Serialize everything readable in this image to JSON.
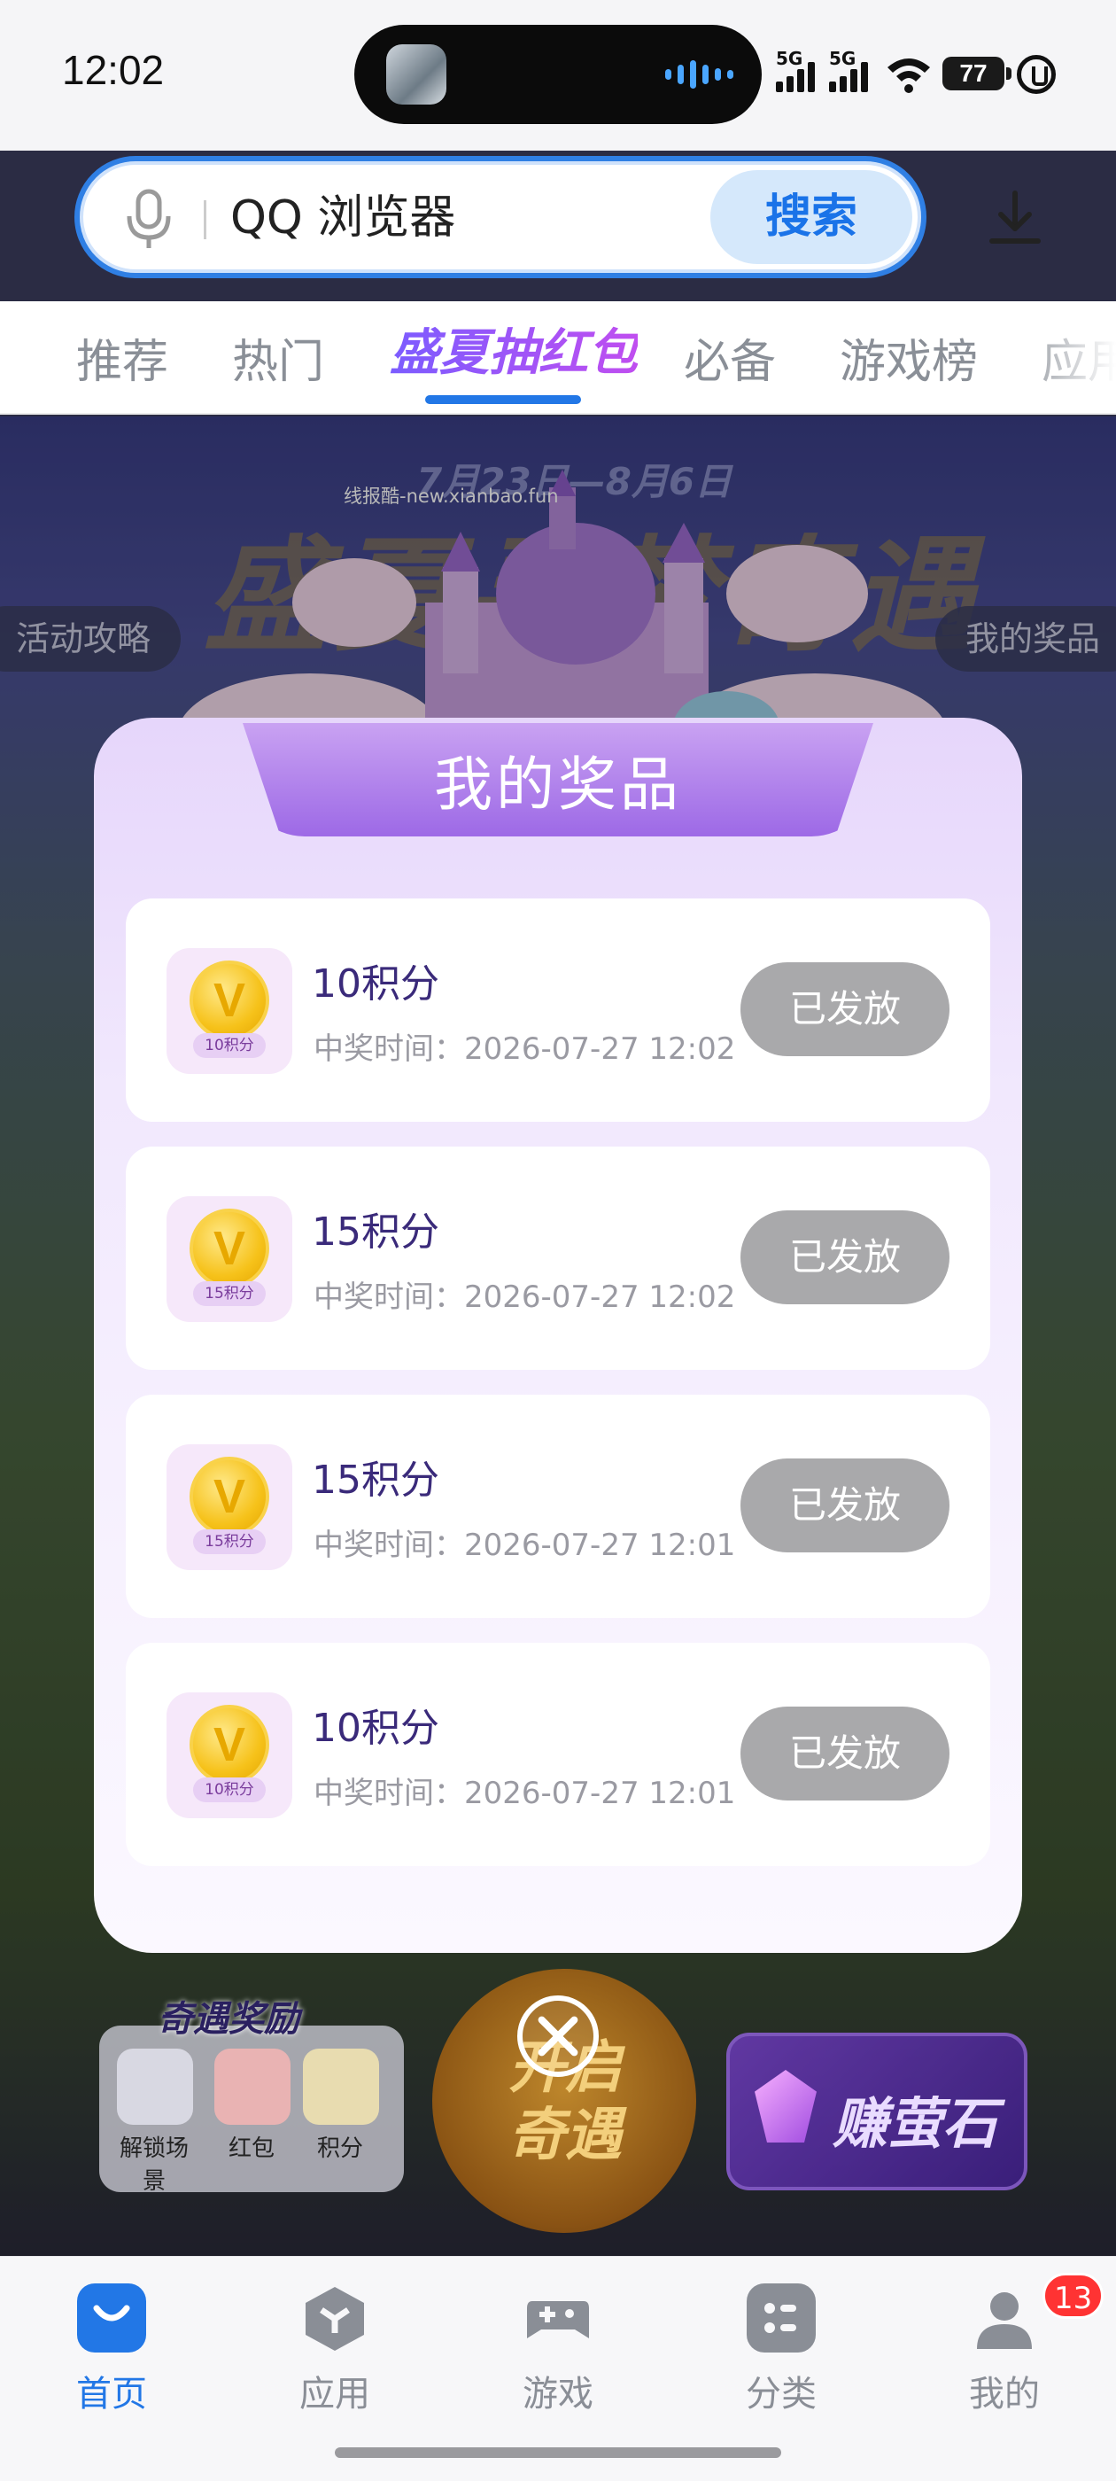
{
  "status_bar": {
    "time": "12:02",
    "signal1_label": "5G",
    "signal2_label": "5G",
    "battery": "77"
  },
  "search": {
    "placeholder": "QQ 浏览器",
    "button_label": "搜索"
  },
  "tabs": [
    "推荐",
    "热门",
    "盛夏抽红包",
    "必备",
    "游戏榜",
    "应用"
  ],
  "background": {
    "date_range": "7月23日—8月6日",
    "title": "盛夏寻梦奇遇",
    "watermark": "线报酷-new.xianbao.fun",
    "guide_button": "活动攻略",
    "prizes_button": "我的奖品",
    "reward_title": "奇遇奖励",
    "rewards": [
      "解锁场景",
      "红包",
      "积分"
    ],
    "open_button": "开启奇遇",
    "earn_button": "赚萤石"
  },
  "modal": {
    "title": "我的奖品",
    "prizes": [
      {
        "icon_label": "10积分",
        "name": "10积分",
        "time": "中奖时间：2026-07-27 12:02",
        "status": "已发放"
      },
      {
        "icon_label": "15积分",
        "name": "15积分",
        "time": "中奖时间：2026-07-27 12:02",
        "status": "已发放"
      },
      {
        "icon_label": "15积分",
        "name": "15积分",
        "time": "中奖时间：2026-07-27 12:01",
        "status": "已发放"
      },
      {
        "icon_label": "10积分",
        "name": "10积分",
        "time": "中奖时间：2026-07-27 12:01",
        "status": "已发放"
      }
    ]
  },
  "nav": {
    "items": [
      {
        "label": "首页",
        "icon": "bag-icon"
      },
      {
        "label": "应用",
        "icon": "apps-icon"
      },
      {
        "label": "游戏",
        "icon": "gamepad-icon"
      },
      {
        "label": "分类",
        "icon": "grid-icon"
      },
      {
        "label": "我的",
        "icon": "profile-icon"
      }
    ],
    "profile_badge": "13"
  },
  "colors": {
    "accent": "#2277e6",
    "modal_header": "#9d69e6",
    "status_button": "#a9a9ab"
  }
}
